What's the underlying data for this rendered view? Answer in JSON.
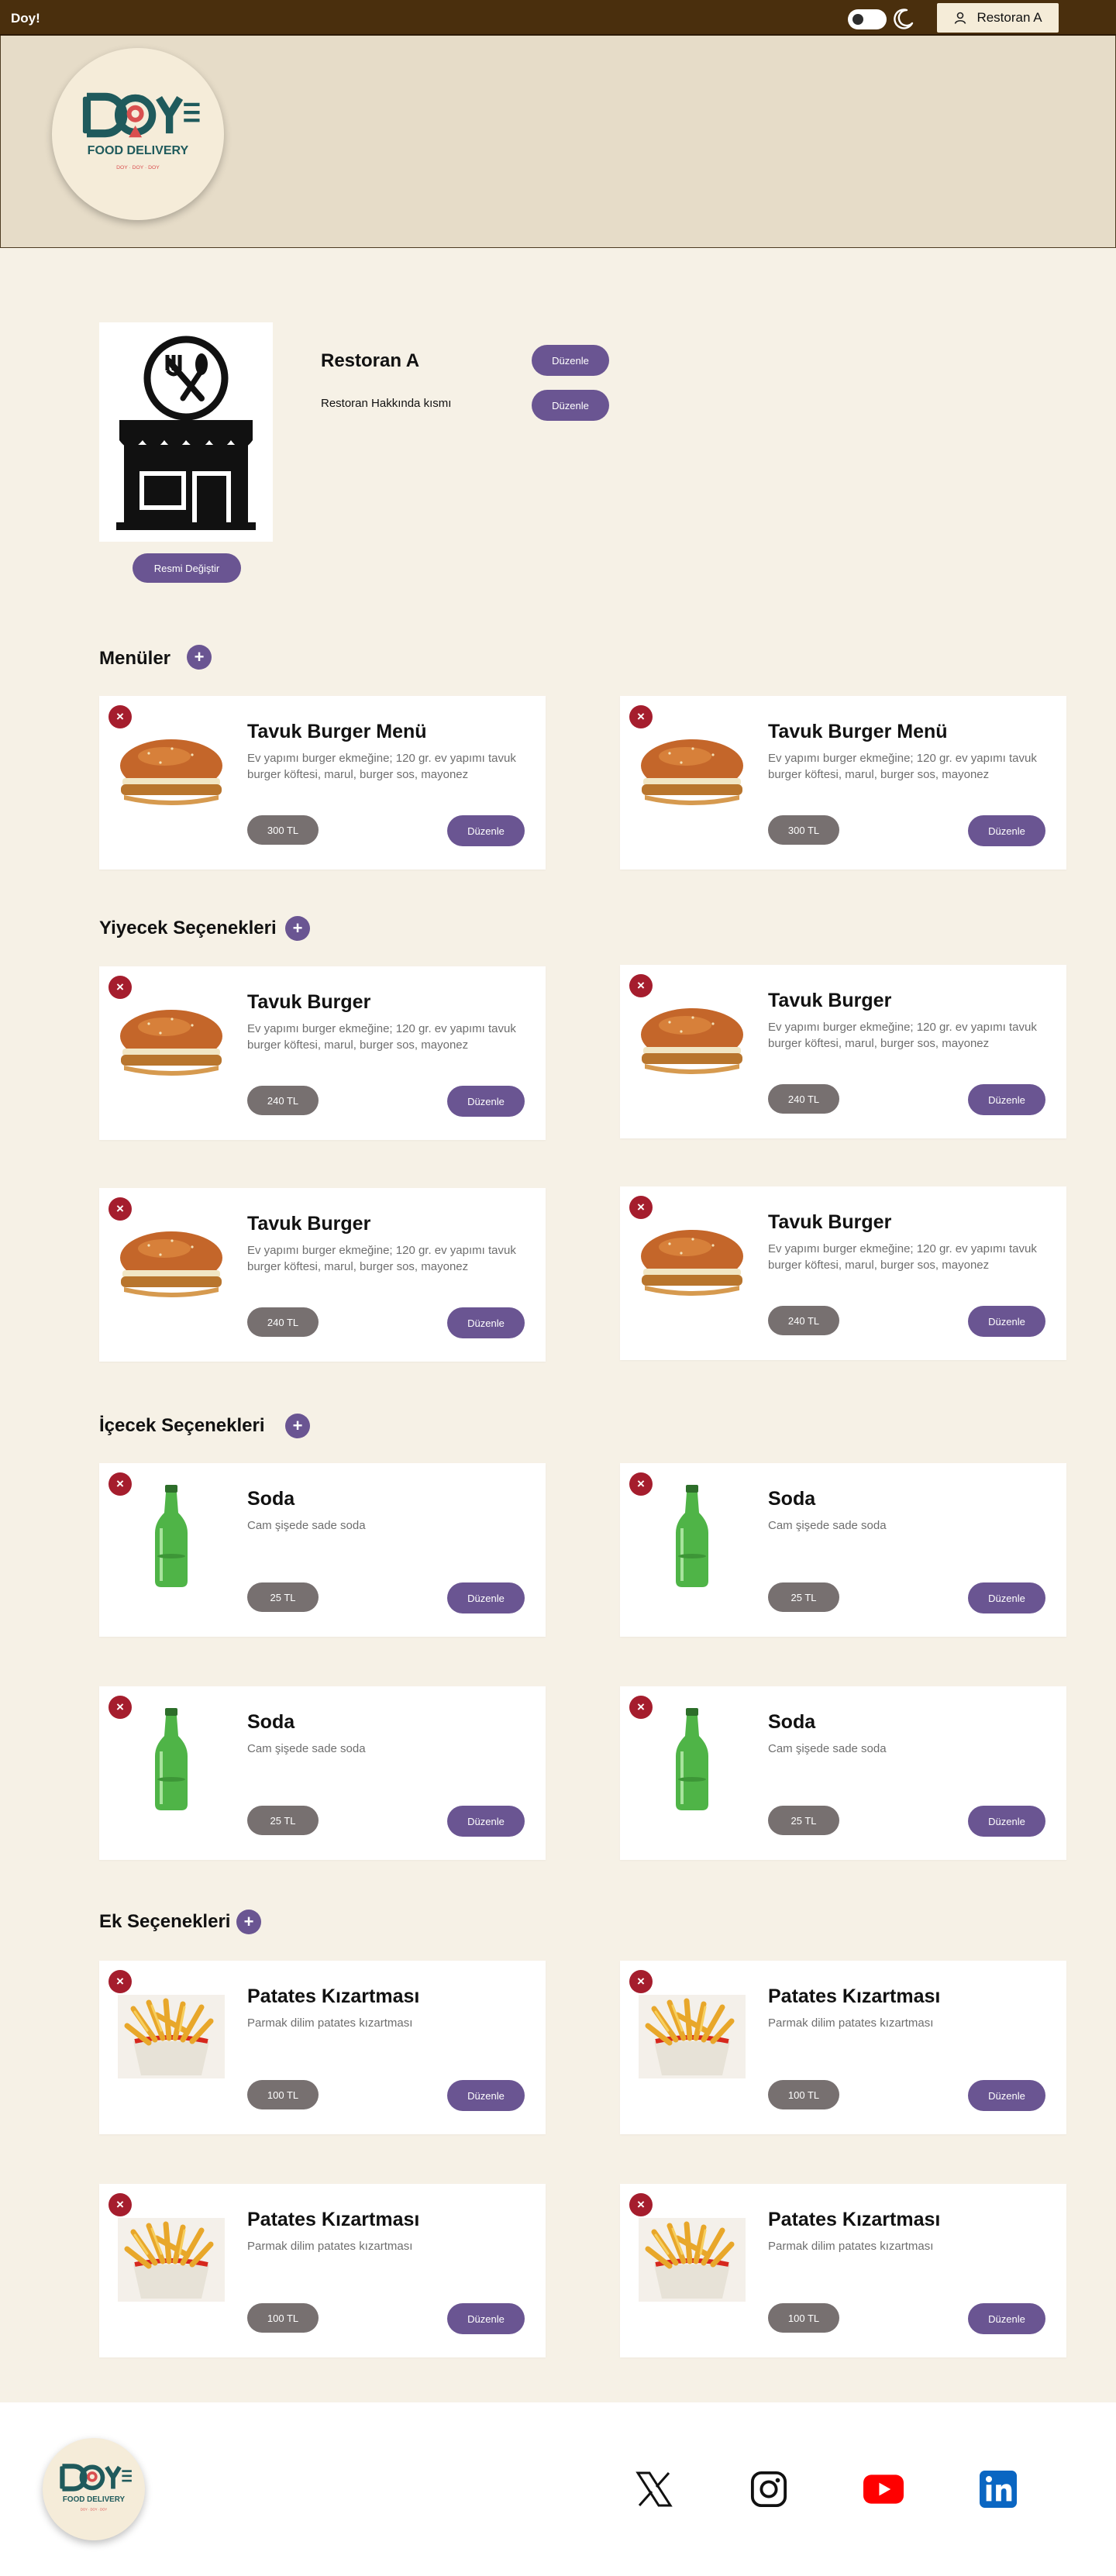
{
  "topbar": {
    "brand": "Doy!",
    "account_label": "Restoran A"
  },
  "logo": {
    "wordmark": "DOY",
    "tagline": "FOOD DELIVERY",
    "subtag": "DOY · DOY · DOY"
  },
  "profile": {
    "name": "Restoran A",
    "about": "Restoran Hakkında kısmı",
    "edit_label": "Düzenle",
    "change_image_label": "Resmi Değiştir"
  },
  "sections": [
    {
      "title": "Menüler",
      "items": [
        {
          "title": "Tavuk Burger Menü",
          "desc": "Ev yapımı burger ekmeğine; 120 gr. ev yapımı tavuk burger köftesi, marul, burger sos, mayonez",
          "price": "300 TL",
          "image": "burger"
        },
        {
          "title": "Tavuk Burger Menü",
          "desc": "Ev yapımı burger ekmeğine; 120 gr. ev yapımı tavuk burger köftesi, marul, burger sos, mayonez",
          "price": "300 TL",
          "image": "burger"
        }
      ]
    },
    {
      "title": "Yiyecek Seçenekleri",
      "items": [
        {
          "title": "Tavuk Burger",
          "desc": "Ev yapımı burger ekmeğine; 120 gr. ev yapımı tavuk burger köftesi, marul, burger sos, mayonez",
          "price": "240 TL",
          "image": "burger"
        },
        {
          "title": "Tavuk Burger",
          "desc": "Ev yapımı burger ekmeğine; 120 gr. ev yapımı tavuk burger köftesi, marul, burger sos, mayonez",
          "price": "240 TL",
          "image": "burger"
        },
        {
          "title": "Tavuk Burger",
          "desc": "Ev yapımı burger ekmeğine; 120 gr. ev yapımı tavuk burger köftesi, marul, burger sos, mayonez",
          "price": "240 TL",
          "image": "burger"
        },
        {
          "title": "Tavuk Burger",
          "desc": "Ev yapımı burger ekmeğine; 120 gr. ev yapımı tavuk burger köftesi, marul, burger sos, mayonez",
          "price": "240 TL",
          "image": "burger"
        }
      ]
    },
    {
      "title": "İçecek Seçenekleri",
      "items": [
        {
          "title": "Soda",
          "desc": "Cam şişede sade soda",
          "price": "25 TL",
          "image": "bottle"
        },
        {
          "title": "Soda",
          "desc": "Cam şişede sade soda",
          "price": "25 TL",
          "image": "bottle"
        },
        {
          "title": "Soda",
          "desc": "Cam şişede sade soda",
          "price": "25 TL",
          "image": "bottle"
        },
        {
          "title": "Soda",
          "desc": "Cam şişede sade soda",
          "price": "25 TL",
          "image": "bottle"
        }
      ]
    },
    {
      "title": "Ek Seçenekleri",
      "items": [
        {
          "title": "Patates Kızartması",
          "desc": "Parmak dilim patates kızartması",
          "price": "100 TL",
          "image": "fries"
        },
        {
          "title": "Patates Kızartması",
          "desc": "Parmak dilim patates kızartması",
          "price": "100 TL",
          "image": "fries"
        },
        {
          "title": "Patates Kızartması",
          "desc": "Parmak dilim patates kızartması",
          "price": "100 TL",
          "image": "fries"
        },
        {
          "title": "Patates Kızartması",
          "desc": "Parmak dilim patates kızartması",
          "price": "100 TL",
          "image": "fries"
        }
      ]
    }
  ],
  "card_labels": {
    "edit": "Düzenle",
    "remove": "×",
    "add": "+"
  },
  "footer": {
    "social": [
      "x-icon",
      "instagram-icon",
      "youtube-icon",
      "linkedin-icon"
    ]
  },
  "colors": {
    "topbar": "#4a2f0d",
    "header": "#e6dcc8",
    "page": "#f6f1e6",
    "accent": "#6a5592",
    "remove": "#a51d2d",
    "price": "#777070"
  }
}
